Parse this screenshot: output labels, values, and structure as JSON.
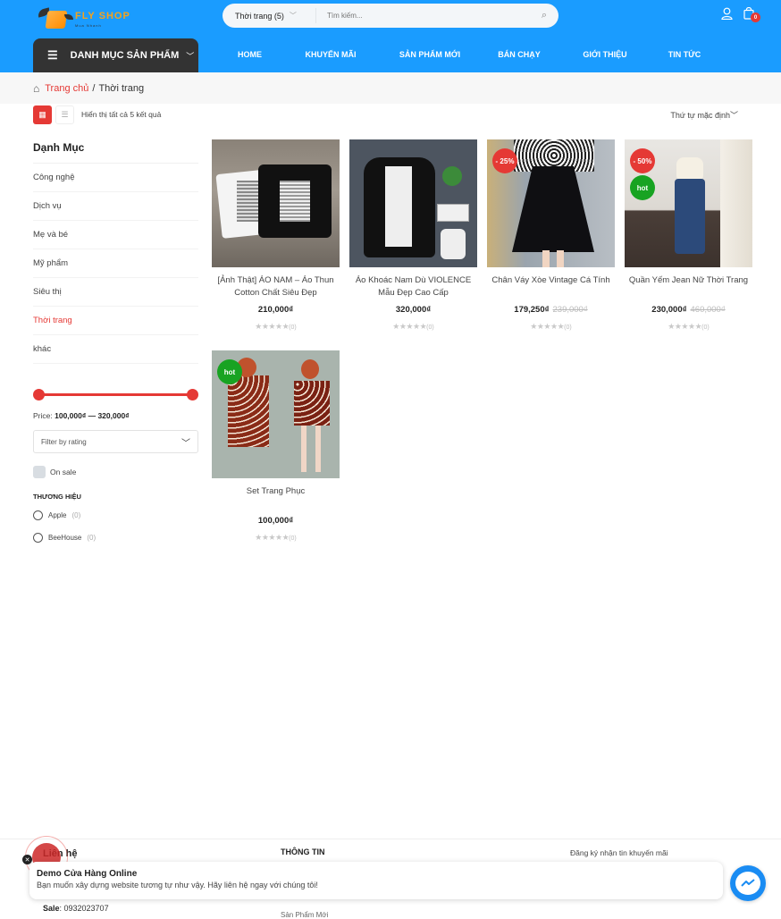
{
  "header": {
    "logo_name": "FLY SHOP",
    "logo_tagline": "Mua Nhanh",
    "search_category": "Thời trang  (5)",
    "search_placeholder": "Tìm kiếm...",
    "cart_count": "0",
    "category_menu_label": "DANH MỤC SẢN PHẨM",
    "nav": [
      "HOME",
      "KHUYẾN MÃI",
      "SẢN PHẨM MỚI",
      "BÁN CHẠY",
      "GIỚI THIỆU",
      "TIN TỨC"
    ]
  },
  "breadcrumb": {
    "home": "Trang chủ",
    "separator": "/",
    "current": "Thời trang"
  },
  "toolbar": {
    "result_count": "Hiển thị tất cả 5 kết quả",
    "sort": "Thứ tự mặc định"
  },
  "sidebar": {
    "title": "Dạnh Mục",
    "categories": [
      "Công nghệ",
      "Dịch vụ",
      "Mẹ và bé",
      "Mỹ phẩm",
      "Siêu thị",
      "Thời trang",
      "khác"
    ],
    "active_category": "Thời trang",
    "price_label": "Price:",
    "price_min": "100,000₫",
    "price_dash": "—",
    "price_max": "320,000₫",
    "price_slider_range_fraction": [
      0,
      1
    ],
    "rating_filter": "Filter by rating",
    "on_sale_label": "On sale",
    "brand_title": "THƯƠNG HIỆU",
    "brands": [
      {
        "name": "Apple",
        "count": "(0)"
      },
      {
        "name": "BeeHouse",
        "count": "(0)"
      }
    ]
  },
  "products": [
    {
      "title": "[Ảnh Thật] ÁO NAM – Áo Thun Cotton Chất Siêu Đẹp",
      "price": "210,000₫",
      "old_price": "",
      "badges": [],
      "rating_count": "(0)",
      "stars": 0
    },
    {
      "title": "Áo Khoác Nam Dù VIOLENCE Mẫu Đẹp Cao Cấp",
      "price": "320,000₫",
      "old_price": "",
      "badges": [],
      "rating_count": "(0)",
      "stars": 0
    },
    {
      "title": "Chân Váy Xòe Vintage Cá Tính",
      "price": "179,250₫",
      "old_price": "239,000₫",
      "badges": [
        {
          "type": "sale",
          "label": "- 25%"
        }
      ],
      "rating_count": "(0)",
      "stars": 0
    },
    {
      "title": "Quần Yếm Jean Nữ Thời Trang",
      "price": "230,000₫",
      "old_price": "460,000₫",
      "badges": [
        {
          "type": "sale",
          "label": "- 50%"
        },
        {
          "type": "hot",
          "label": "hot"
        }
      ],
      "rating_count": "(0)",
      "stars": 0
    },
    {
      "title": "Set Trang Phục",
      "price": "100,000₫",
      "old_price": "",
      "badges": [
        {
          "type": "hot",
          "label": "hot"
        }
      ],
      "rating_count": "(0)",
      "stars": 0
    }
  ],
  "footer": {
    "contact_title": "Liên hệ",
    "info_title": "THÔNG TIN",
    "newsletter_title": "Đăng ký nhận tin khuyến mãi",
    "sale_label": "Sale",
    "sale_phone": ": 0932023707",
    "info_peek": "Sản Phẩm Mới"
  },
  "popup": {
    "title": "Demo Cửa Hàng Online",
    "message": "Bạn muốn xây dựng website tương tự như vậy. Hãy liên hệ ngay với chúng tôi!"
  },
  "colors": {
    "header_bg": "#1a9cff",
    "accent_red": "#e53935",
    "hot_green": "#18a322",
    "menu_dark": "#333333"
  }
}
